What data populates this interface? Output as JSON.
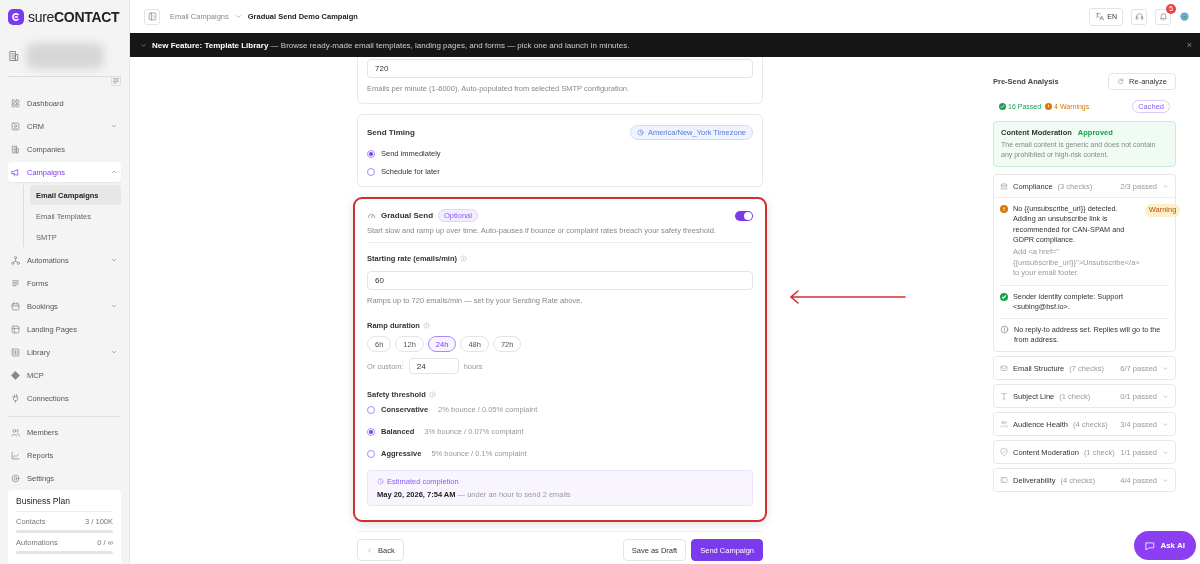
{
  "sidebar": {
    "logo": {
      "prefix": "sure",
      "name": "CONTACT"
    },
    "nav": [
      {
        "label": "Dashboard",
        "selected": false
      },
      {
        "label": "CRM",
        "selected": false,
        "expanded": false
      },
      {
        "label": "Companies",
        "selected": false
      },
      {
        "label": "Campaigns",
        "selected": true,
        "expanded": true,
        "children": [
          {
            "label": "Email Campaigns",
            "selected": true
          },
          {
            "label": "Email Templates",
            "selected": false
          },
          {
            "label": "SMTP",
            "selected": false
          }
        ]
      },
      {
        "label": "Automations",
        "selected": false,
        "expanded": false
      },
      {
        "label": "Forms",
        "selected": false
      },
      {
        "label": "Bookings",
        "selected": false,
        "expanded": false
      },
      {
        "label": "Landing Pages",
        "selected": false
      },
      {
        "label": "Library",
        "selected": false,
        "expanded": false
      },
      {
        "label": "MCP",
        "selected": false
      },
      {
        "label": "Connections",
        "selected": false
      }
    ],
    "nav_secondary": [
      {
        "label": "Members",
        "selected": false
      },
      {
        "label": "Reports",
        "selected": false
      },
      {
        "label": "Settings",
        "selected": false
      }
    ],
    "plan": {
      "title": "Business Plan",
      "meters": [
        {
          "label": "Contacts",
          "reading": "3 / 100K",
          "level": 0
        },
        {
          "label": "Automations",
          "reading": "0 / ∞",
          "level": 0
        }
      ]
    }
  },
  "header": {
    "breadcrumbs": [
      {
        "label": "Email Campaigns",
        "current": false
      },
      {
        "label": "Gradual Send Demo Campaign",
        "current": true
      }
    ],
    "language": "EN",
    "notifications": "5"
  },
  "banner": {
    "text": "**New Feature:**  **Template Library** — Browse ready-made email templates, landing pages, and forms — pick one and launch in minutes.",
    "close": "×"
  },
  "rate_card": {
    "value": "720",
    "help": "Emails per minute (1-6000). Auto-populated from selected SMTP configuration."
  },
  "timing": {
    "title": "Send Timing",
    "timezone": "America/New_York Timezone",
    "options": [
      {
        "label": "Send immediately",
        "selected": true
      },
      {
        "label": "Schedule for later",
        "selected": false
      }
    ]
  },
  "gradual": {
    "title": "Gradual Send",
    "badge": "Optional",
    "on": true,
    "description": "Start slow and ramp up over time. Auto-pauses if bounce or complaint rates breach your safety threshold.",
    "starting_rate": {
      "label": "Starting rate (emails/min)",
      "value": "60",
      "help": "Ramps up to 720 emails/min — set by your Sending Rate above."
    },
    "ramp": {
      "label": "Ramp duration",
      "presets": [
        {
          "label": "6h",
          "selected": false
        },
        {
          "label": "12h",
          "selected": false
        },
        {
          "label": "24h",
          "selected": true
        },
        {
          "label": "48h",
          "selected": false
        },
        {
          "label": "72h",
          "selected": false
        }
      ],
      "custom_label": "Or custom:",
      "custom_value": "24",
      "unit": "hours"
    },
    "threshold": {
      "label": "Safety threshold",
      "options": [
        {
          "label": "Conservative",
          "detail": "2% bounce / 0.05% complaint",
          "selected": false
        },
        {
          "label": "Balanced",
          "detail": "3% bounce / 0.07% complaint",
          "selected": true
        },
        {
          "label": "Aggressive",
          "detail": "5% bounce / 0.1% complaint",
          "selected": false
        }
      ]
    },
    "estimate": {
      "label": "Estimated completion",
      "text": "**May 20, 2026, 7:54 AM** — under an hour to send 2 emails"
    }
  },
  "actions": {
    "back": "Back",
    "draft": "Save as Draft",
    "send": "Send Campaign"
  },
  "analysis": {
    "title": "Pre-Send Analysis",
    "reanalyze": "Re-analyze",
    "passed": "16 Passed",
    "warnings": "4 Warnings",
    "cached": "Cached",
    "moderation": {
      "title": "Content Moderation",
      "status": "Approved",
      "text": "The email content is generic and does not contain any prohibited or high-risk content."
    },
    "sections": [
      {
        "title": "Compliance",
        "count": "(3 checks)",
        "result": "2/3 passed",
        "expanded": true,
        "items": [
          {
            "kind": "warning",
            "text": "No {{unsubscribe_url}} detected. Adding an unsubscribe link is recommended for CAN-SPAM and GDPR compliance.",
            "badge": "Warning",
            "hint": "Add <a href=\"{{unsubscribe_url}}\">Unsubscribe</a> to your email footer."
          },
          {
            "kind": "pass",
            "text": "Sender identity complete: Support <subing@bsf.io>."
          },
          {
            "kind": "info",
            "text": "No reply-to address set. Replies will go to the from address."
          }
        ]
      },
      {
        "title": "Email Structure",
        "count": "(7 checks)",
        "result": "6/7 passed",
        "expanded": false
      },
      {
        "title": "Subject Line",
        "count": "(1 check)",
        "result": "0/1 passed",
        "expanded": false
      },
      {
        "title": "Audience Health",
        "count": "(4 checks)",
        "result": "3/4 passed",
        "expanded": false
      },
      {
        "title": "Content Moderation",
        "count": "(1 check)",
        "result": "1/1 passed",
        "expanded": false
      },
      {
        "title": "Deliverability",
        "count": "(4 checks)",
        "result": "4/4 passed",
        "expanded": false
      }
    ]
  },
  "ask_ai": "Ask AI"
}
